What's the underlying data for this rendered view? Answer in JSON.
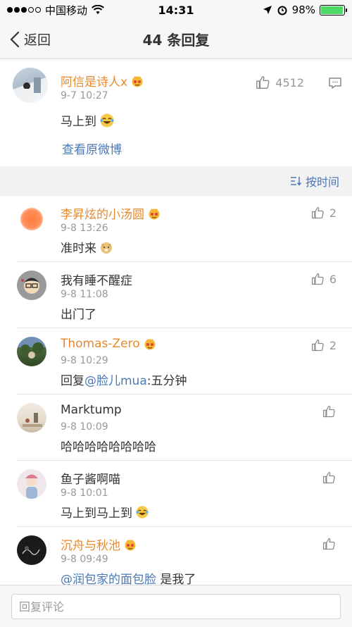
{
  "status_bar": {
    "carrier": "中国移动",
    "time": "14:31",
    "battery": "98%",
    "battery_level": 0.98
  },
  "nav": {
    "back_label": "返回",
    "title": "44 条回复"
  },
  "original": {
    "name": "阿信是诗人x",
    "time": "9-7 10:27",
    "content": "马上到",
    "likes": "4512",
    "view_original": "查看原微博"
  },
  "sort_label": "按时间",
  "replies": [
    {
      "name": "李昇炫的小汤圆",
      "time": "9-8 13:26",
      "content": "准时来",
      "likes": "2",
      "vip": true
    },
    {
      "name": "我有睡不醒症",
      "time": "9-8 11:08",
      "content": "出门了",
      "likes": "6",
      "vip": false
    },
    {
      "name": "Thomas-Zero",
      "time": "9-8 10:29",
      "content_prefix": "回复",
      "mention": "@脸儿mua",
      "content": ":五分钟",
      "likes": "2",
      "vip": true
    },
    {
      "name": "Marktump",
      "time": "9-8 10:09",
      "content": "哈哈哈哈哈哈哈哈",
      "likes": "",
      "vip": false
    },
    {
      "name": "鱼子酱啊喵",
      "time": "9-8 10:01",
      "content": "马上到马上到",
      "likes": "",
      "vip": false
    },
    {
      "name": "沉舟与秋池",
      "time": "9-8 09:49",
      "mention": "@润包家的面包脸",
      "content": " 是我了",
      "likes": "",
      "vip": true
    }
  ],
  "reply_bar": {
    "placeholder": "回复评论"
  },
  "colors": {
    "vip_name": "#e8892b",
    "link": "#4a78b4",
    "meta": "#999999"
  }
}
